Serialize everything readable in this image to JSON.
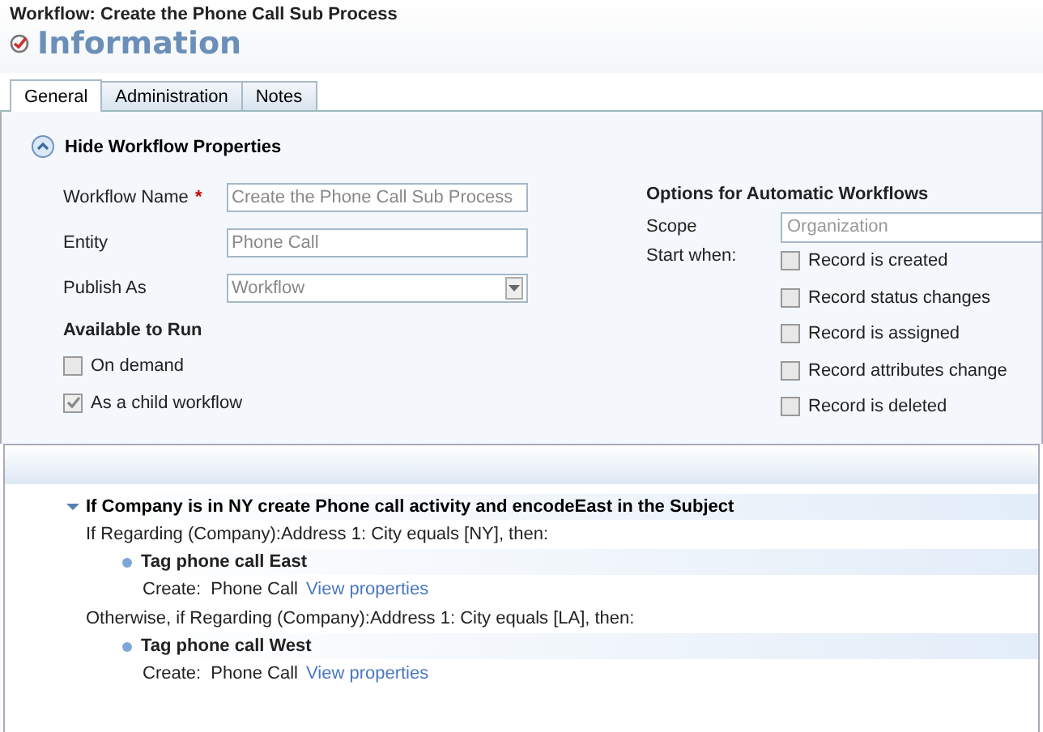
{
  "window": {
    "title": "Workflow: Create the Phone Call Sub Process"
  },
  "heading": "Information",
  "tabs": [
    {
      "label": "General",
      "selected": true
    },
    {
      "label": "Administration",
      "selected": false
    },
    {
      "label": "Notes",
      "selected": false
    }
  ],
  "required_mark": "*",
  "section": {
    "label": "Hide Workflow Properties",
    "expanded": true
  },
  "fields": [
    {
      "label": "Workflow Name",
      "required": true,
      "kind": "text",
      "value": "Create the Phone Call Sub Process"
    },
    {
      "label": "Entity",
      "required": false,
      "kind": "text",
      "value": "Phone Call"
    },
    {
      "label": "Publish As",
      "required": false,
      "kind": "select",
      "value": "Workflow"
    }
  ],
  "available_to_run": {
    "title": "Available to Run",
    "options": [
      {
        "label": "On demand",
        "checked": false
      },
      {
        "label": "As a child workflow",
        "checked": true
      }
    ]
  },
  "automatic": {
    "title": "Options for Automatic Workflows",
    "scope_label": "Scope",
    "scope_value": "Organization",
    "start_label": "Start when:",
    "options": [
      {
        "label": "Record is created",
        "checked": false
      },
      {
        "label": "Record status changes",
        "checked": false
      },
      {
        "label": "Record is assigned",
        "checked": false
      },
      {
        "label": "Record attributes change",
        "checked": false
      },
      {
        "label": "Record is deleted",
        "checked": false
      }
    ]
  },
  "steps": {
    "title": "If Company is in NY create Phone call activity and encodeEast in the Subject",
    "expanded": true,
    "items": [
      {
        "kind": "condition",
        "text": "If Regarding (Company):Address 1: City equals [NY], then:"
      },
      {
        "kind": "action",
        "title": "Tag phone call East",
        "detail": "Create:  Phone Call",
        "link": "View properties"
      },
      {
        "kind": "condition",
        "text": "Otherwise, if Regarding (Company):Address 1: City equals [LA], then:"
      },
      {
        "kind": "action",
        "title": "Tag phone call West",
        "detail": "Create:  Phone Call",
        "link": "View properties"
      }
    ]
  }
}
